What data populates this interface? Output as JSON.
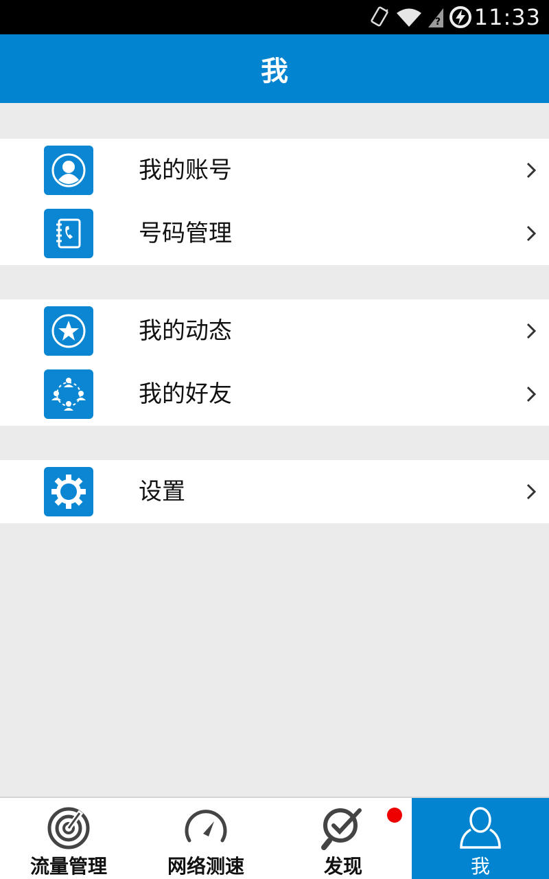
{
  "status_bar": {
    "time": "11:33",
    "icons": [
      "vibrate-icon",
      "wifi-icon",
      "signal-icon",
      "battery-charging-icon"
    ]
  },
  "header": {
    "title": "我"
  },
  "menu_groups": [
    {
      "items": [
        {
          "label": "我的账号",
          "icon": "account-icon"
        },
        {
          "label": "号码管理",
          "icon": "contacts-book-icon"
        }
      ]
    },
    {
      "items": [
        {
          "label": "我的动态",
          "icon": "star-icon"
        },
        {
          "label": "我的好友",
          "icon": "friends-icon"
        }
      ]
    },
    {
      "items": [
        {
          "label": "设置",
          "icon": "gear-icon"
        }
      ]
    }
  ],
  "tabs": [
    {
      "label": "流量管理",
      "icon": "traffic-radar-icon",
      "active": false
    },
    {
      "label": "网络测速",
      "icon": "speedometer-icon",
      "active": false
    },
    {
      "label": "发现",
      "icon": "discover-icon",
      "active": false,
      "badge": true
    },
    {
      "label": "我",
      "icon": "person-icon",
      "active": true
    }
  ],
  "colors": {
    "primary": "#0284d0",
    "background": "#ebebeb",
    "badge": "#ee0000"
  }
}
